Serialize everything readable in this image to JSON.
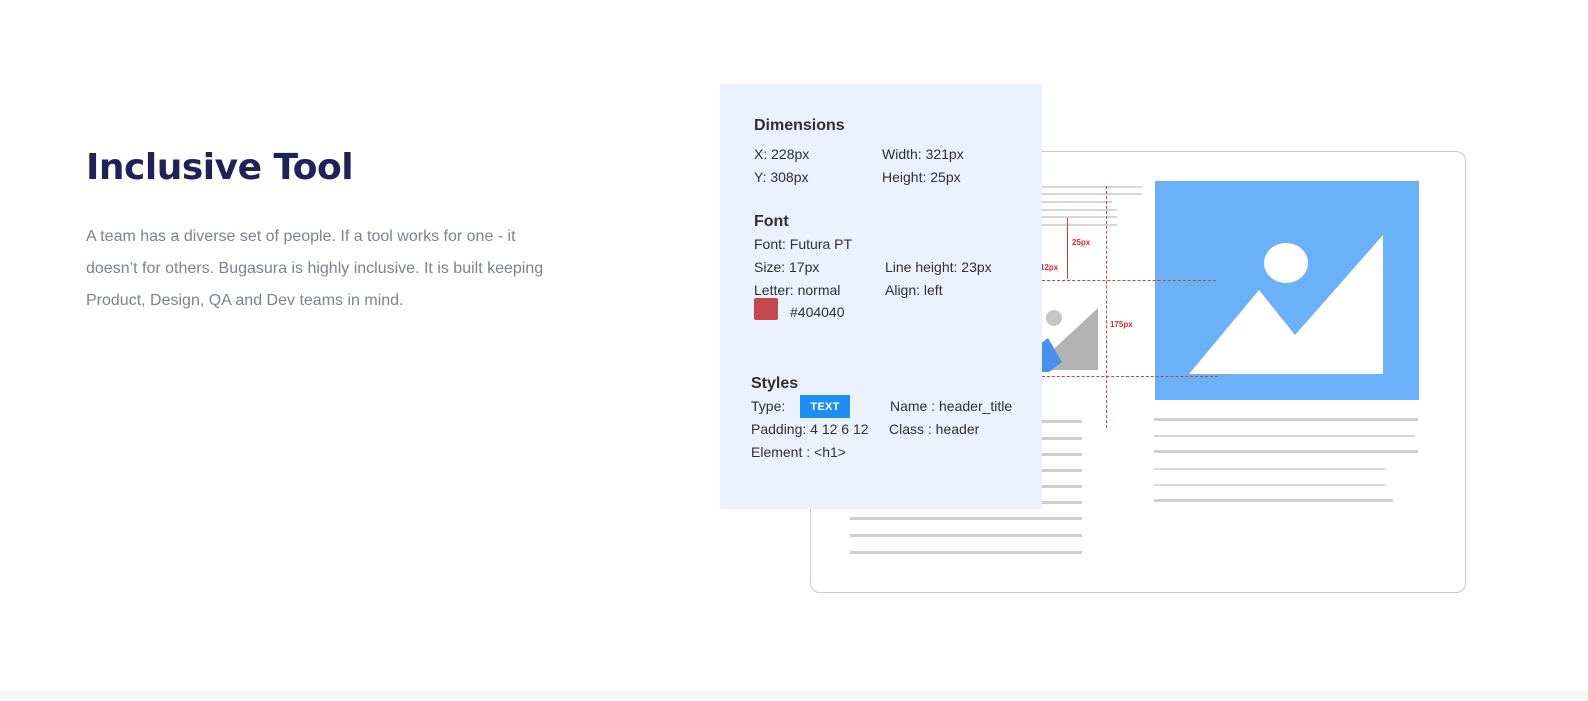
{
  "hero": {
    "title": "Inclusive Tool",
    "description": "A team has a diverse set of people. If a tool works for one - it doesn’t for others. Bugasura is highly inclusive. It is built keeping Product, Design, QA and Dev teams in mind."
  },
  "mockup": {
    "measure_labels": [
      "25px",
      "12px",
      "175px"
    ],
    "image_colors": {
      "big_image_bg": "#6ab1f8",
      "small_image_fg": "#b3b3b3",
      "accent_blue": "#4a8ff0",
      "measure_line": "#e03a3a"
    }
  },
  "inspect_panel": {
    "dimensions": {
      "heading": "Dimensions",
      "x": "X: 228px",
      "y": "Y: 308px",
      "width": "Width: 321px",
      "height": "Height: 25px"
    },
    "font": {
      "heading": "Font",
      "family": "Font:  Futura PT",
      "size": "Size: 17px",
      "line_height": "Line height: 23px",
      "letter": "Letter: normal",
      "align": "Align: left",
      "color_hex": "#404040",
      "swatch_color": "#c5484f"
    },
    "styles": {
      "heading": "Styles",
      "type_label": "Type:",
      "type_badge": "TEXT",
      "name": "Name : header_title",
      "padding": "Padding: 4 12 6 12",
      "class": "Class : header",
      "element": "Element : <h1>"
    }
  }
}
